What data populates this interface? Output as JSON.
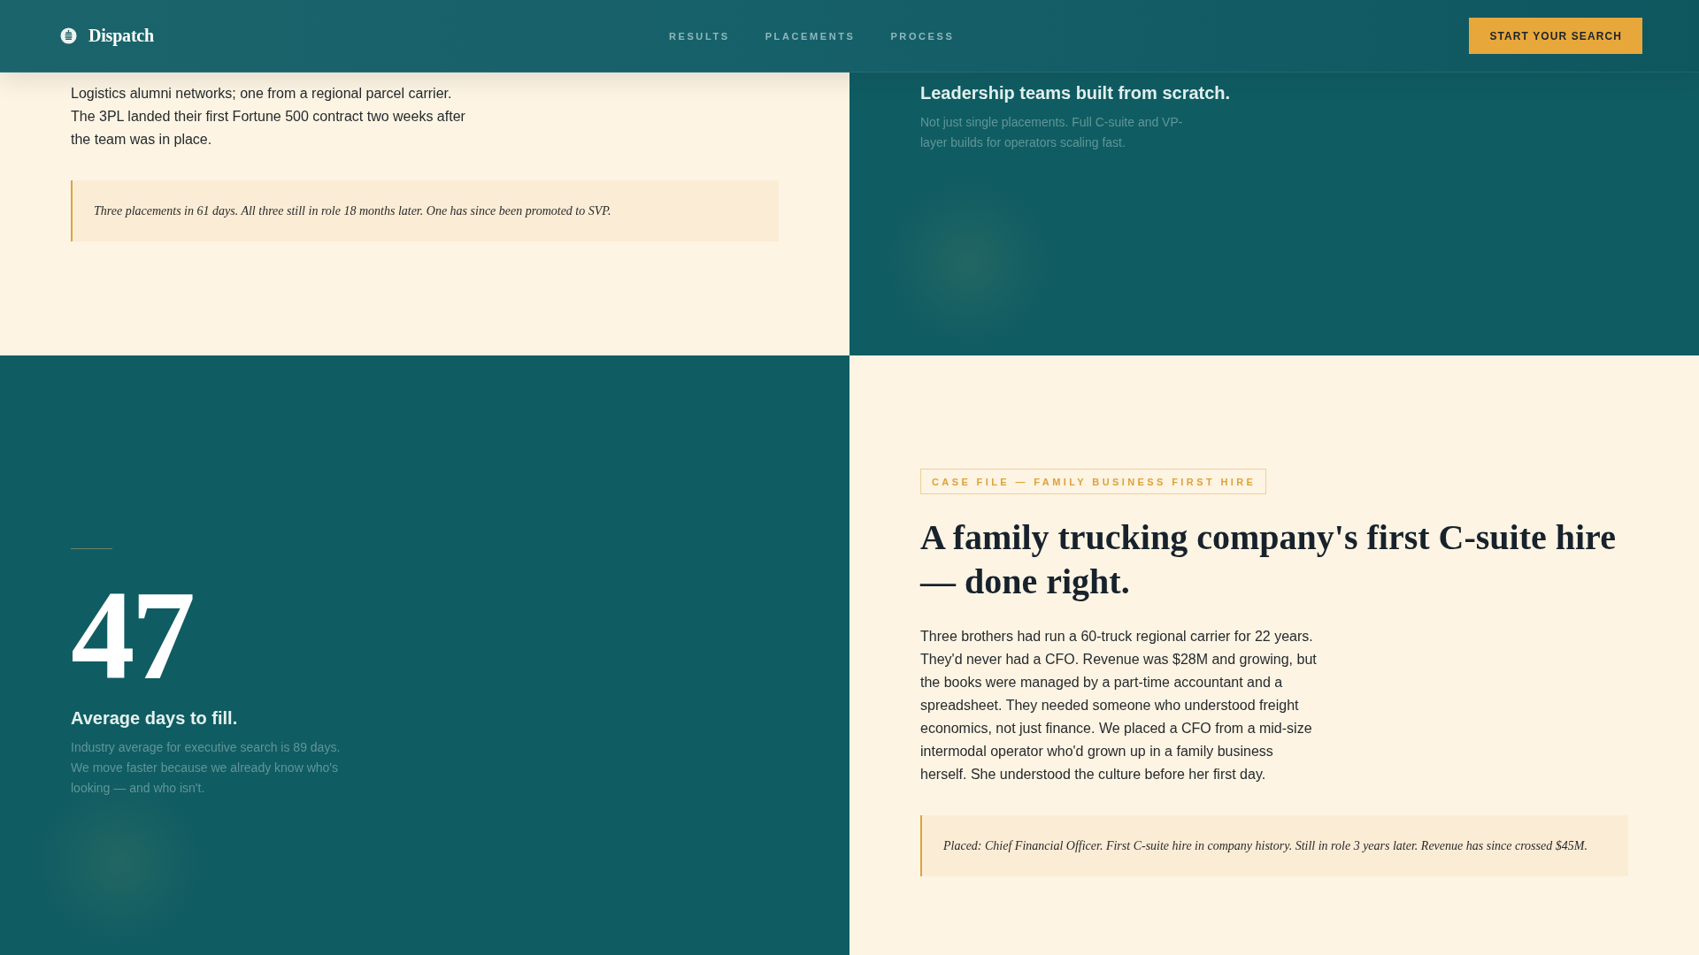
{
  "header": {
    "logo": {
      "name": "Dispatch"
    },
    "nav": [
      {
        "label": "RESULTS"
      },
      {
        "label": "PLACEMENTS"
      },
      {
        "label": "PROCESS"
      }
    ],
    "cta": {
      "label": "START YOUR SEARCH"
    }
  },
  "rows": [
    {
      "panels": [
        {
          "kind": "case",
          "body": "Logistics alumni networks; one from a regional parcel carrier. The 3PL landed their first Fortune 500 contract two weeks after the team was in place.",
          "callout": "Three placements in 61 days. All three still in role 18 months later. One has since been promoted to SVP."
        },
        {
          "kind": "stat",
          "title": "Leadership teams built from scratch.",
          "description": "Not just single placements. Full C-suite and VP-layer builds for operators scaling fast."
        }
      ]
    },
    {
      "panels": [
        {
          "kind": "stat",
          "number": "47",
          "title": "Average days to fill.",
          "description": "Industry average for executive search is 89 days. We move faster because we already know who's looking — and who isn't."
        },
        {
          "kind": "case",
          "tag": "CASE FILE — FAMILY BUSINESS FIRST HIRE",
          "title": "A family trucking company's first C-suite hire — done right.",
          "body": "Three brothers had run a 60-truck regional carrier for 22 years. They'd never had a CFO. Revenue was $28M and growing, but the books were managed by a part-time accountant and a spreadsheet. They needed someone who understood freight economics, not just finance. We placed a CFO from a mid-size intermodal operator who'd grown up in a family business herself. She understood the culture before her first day.",
          "callout": "Placed: Chief Financial Officer. First C-suite hire in company history. Still in role 3 years later. Revenue has since crossed $45M."
        }
      ]
    }
  ]
}
